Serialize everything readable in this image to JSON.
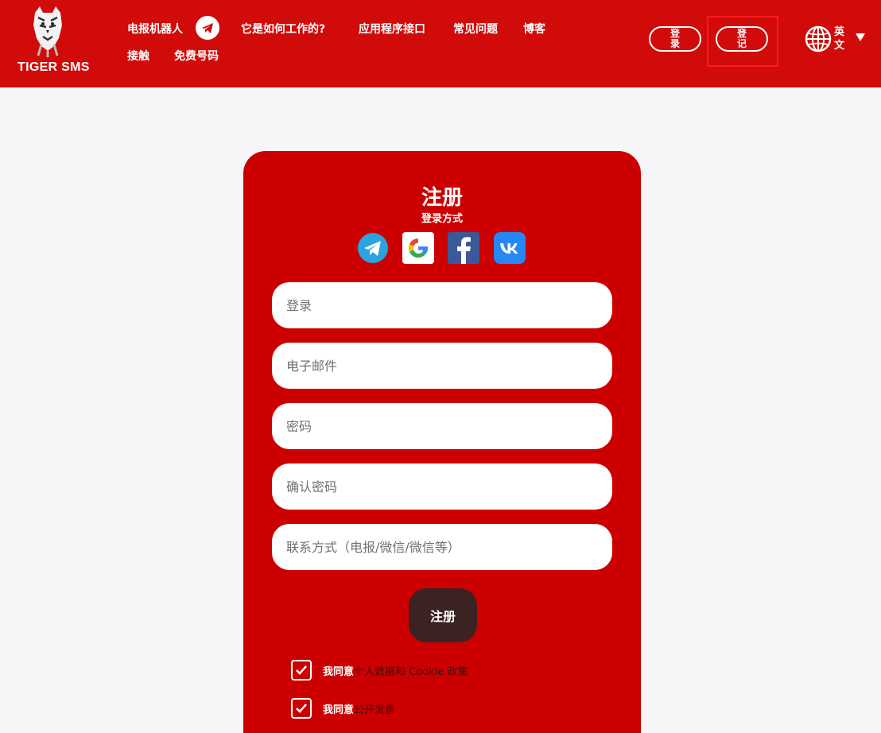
{
  "header": {
    "brand": "TIGER SMS",
    "nav": {
      "bot": "电报机器人",
      "how": "它是如何工作的?",
      "api": "应用程序接口",
      "faq": "常见问题",
      "blog": "博客",
      "contacts": "接触",
      "free": "免费号码"
    },
    "login_btn": "登录",
    "register_btn": "登记",
    "language": "英文"
  },
  "form": {
    "title": "注册",
    "subtitle": "登录方式",
    "social": [
      "telegram-icon",
      "google-icon",
      "facebook-icon",
      "vk-icon"
    ],
    "fields": {
      "login": "登录",
      "email": "电子邮件",
      "password": "密码",
      "confirm": "确认密码",
      "contact": "联系方式（电报/微信/微信等）"
    },
    "submit": "注册",
    "agree1": {
      "prefix": "我同意",
      "text": "个人数据和 Cookie 政策"
    },
    "agree2": {
      "prefix": "我同意",
      "text": "公开发售"
    }
  },
  "colors": {
    "brand_red": "#d10a0a",
    "card_red": "#cc0000",
    "submit_dark": "#3a2322",
    "highlight": "#ff1a1a"
  }
}
